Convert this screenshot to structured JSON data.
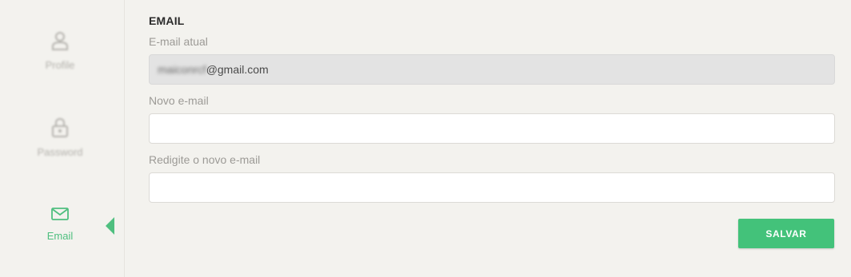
{
  "sidebar": {
    "items": [
      {
        "label": "Profile",
        "icon": "user-icon",
        "active": false
      },
      {
        "label": "Password",
        "icon": "lock-icon",
        "active": false
      },
      {
        "label": "Email",
        "icon": "envelope-icon",
        "active": true
      }
    ]
  },
  "form": {
    "title": "EMAIL",
    "current_email": {
      "label": "E-mail atual",
      "value_obscured": "maiconrcf",
      "value_visible": "@gmail.com"
    },
    "new_email": {
      "label": "Novo e-mail",
      "value": "",
      "placeholder": ""
    },
    "confirm_email": {
      "label": "Redigite o novo e-mail",
      "value": "",
      "placeholder": ""
    },
    "save_label": "SALVAR"
  },
  "colors": {
    "accent": "#43c27a",
    "background": "#f3f2ee",
    "readonly_field": "#e3e3e3"
  }
}
